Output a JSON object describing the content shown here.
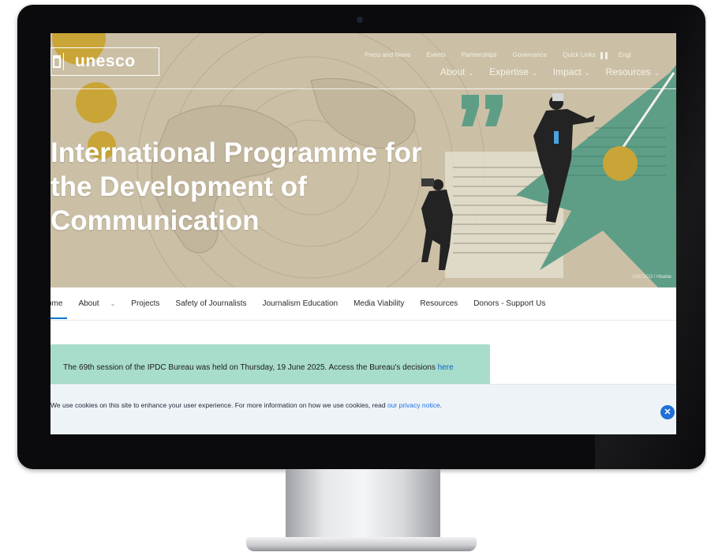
{
  "header": {
    "logo_text": "unesco",
    "utility_links": [
      "Press and News",
      "Events",
      "Partnerships",
      "Governance",
      "Quick Links",
      "Engl"
    ],
    "main_nav": [
      {
        "label": "About"
      },
      {
        "label": "Expertise"
      },
      {
        "label": "Impact"
      },
      {
        "label": "Resources"
      }
    ]
  },
  "hero": {
    "title_lines": [
      "International Programme for",
      "the Development of",
      "Communication"
    ],
    "credit": "UNESCO / Hbalde"
  },
  "section_nav": {
    "items": [
      "ome",
      "About",
      "Projects",
      "Safety of Journalists",
      "Journalism Education",
      "Media Viability",
      "Resources",
      "Donors - Support Us"
    ]
  },
  "notice": {
    "text_before": "The 69th session of the IPDC Bureau was held on Thursday, 19 June 2025. Access the Bureau's decisions ",
    "link_text": "here"
  },
  "cookie_banner": {
    "text_before": "We use cookies on this site to enhance your user experience. For more information on how we use cookies, read ",
    "link_text": "our privacy notice",
    "text_after": ".",
    "close_icon": "close-icon"
  },
  "colors": {
    "hero_bg": "#c9bea5",
    "accent_green": "#5e9e86",
    "mustard": "#c9a537",
    "notice_bg": "#a8dccb",
    "link": "#0b63c4",
    "active_tab": "#0077d4",
    "close_button": "#1f6fd6"
  }
}
